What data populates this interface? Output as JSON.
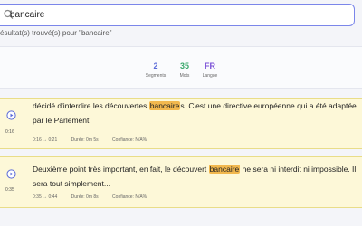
{
  "search": {
    "value": "bancaire",
    "results_text": "ésultat(s) trouvé(s) pour \"bancaire\""
  },
  "stats": [
    {
      "value": "2",
      "label": "Segments",
      "color": "#5a6ad8"
    },
    {
      "value": "35",
      "label": "Mots",
      "color": "#39a86b"
    },
    {
      "value": "FR",
      "label": "Langue",
      "color": "#7a4fd6"
    }
  ],
  "results": [
    {
      "side_time": "0:16",
      "text_before": "décidé d'interdire les découvertes ",
      "highlight": "bancaire",
      "text_after": "s. C'est une directive européenne qui a été adaptée par le Parlement.",
      "range": "0:16 → 0:21",
      "duration": "Durée: 0m 5s",
      "confidence": "Confiance: N/A%"
    },
    {
      "side_time": "0:35",
      "text_before": "Deuxième point très important, en fait, le découvert ",
      "highlight": "bancaire",
      "text_after": " ne sera ni interdit ni impossible. Il sera tout simplement...",
      "range": "0:35 → 0:44",
      "duration": "Durée: 0m 8s",
      "confidence": "Confiance: N/A%"
    }
  ],
  "colors": {
    "accent": "#7b86ea",
    "highlight": "#f2b84e",
    "card_bg": "#fdf8d8"
  }
}
